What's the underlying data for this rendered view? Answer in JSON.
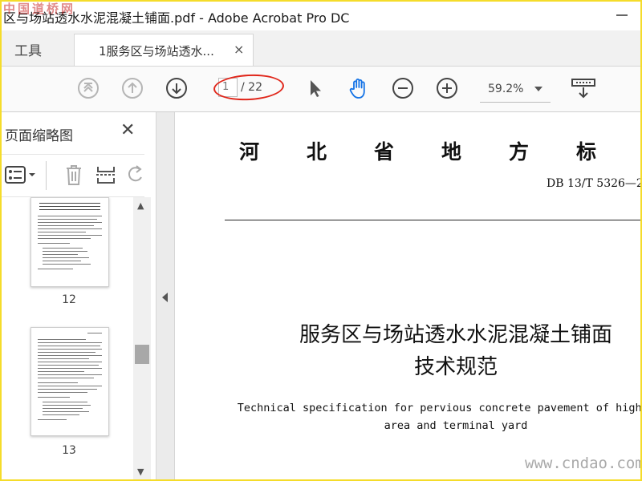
{
  "window": {
    "title": "区与场站透水水泥混凝土铺面.pdf - Adobe Acrobat Pro DC",
    "watermark_top": "中国道桥网"
  },
  "tabs": {
    "tools_label": "工具",
    "doc_label": "1服务区与场站透水...",
    "close_glyph": "×"
  },
  "toolbar": {
    "page_current": "1",
    "page_total": "/ 22",
    "zoom": "59.2%",
    "icons": [
      "first-page-icon",
      "prev-page-icon",
      "next-page-icon",
      "select-cursor-icon",
      "hand-tool-icon",
      "zoom-out-icon",
      "zoom-in-icon",
      "page-display-icon"
    ],
    "highlight_color": "#e0261a",
    "accent_color": "#1473e6"
  },
  "left_panel": {
    "title": "页面缩略图",
    "close_glyph": "✕",
    "thumbnails": [
      {
        "label": "12"
      },
      {
        "label": "13"
      }
    ]
  },
  "document": {
    "header_chars": [
      "河",
      "北",
      "省",
      "地",
      "方",
      "标"
    ],
    "standard_code": "DB 13/T 5326—2",
    "title_line1": "服务区与场站透水水泥混凝土铺面",
    "title_line2": "技术规范",
    "en_line1": "Technical specification for pervious concrete pavement of highway s",
    "en_line2": "area and terminal yard"
  },
  "watermark_bottom": "www.cndao.com"
}
